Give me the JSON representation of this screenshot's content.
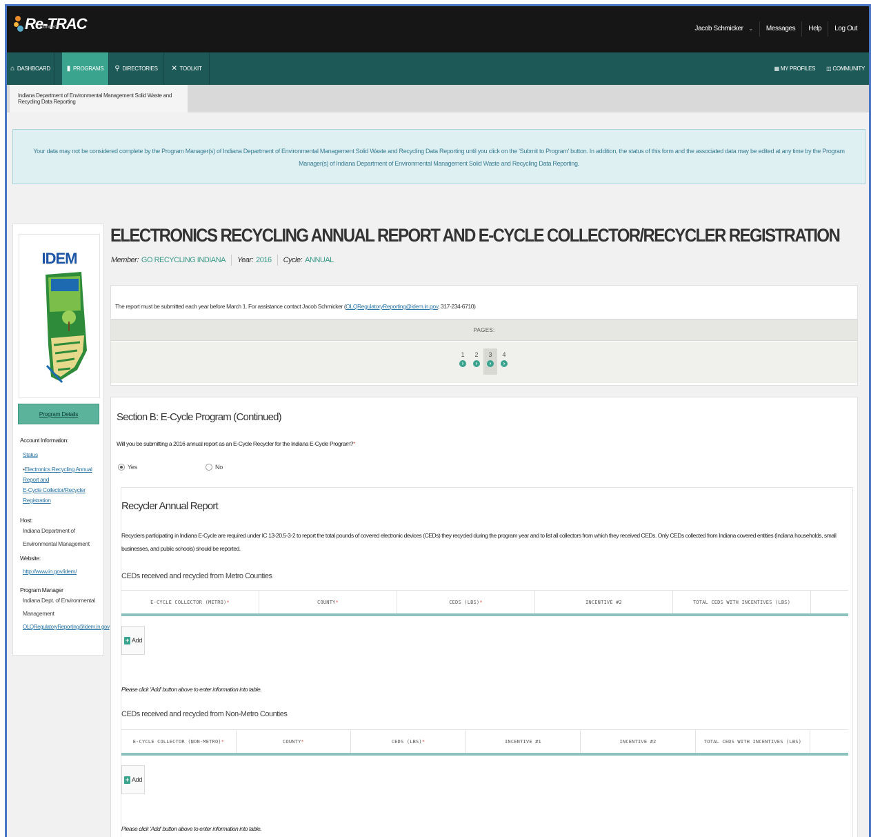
{
  "topbar": {
    "logo": "Re-TRAC",
    "logo_sub": "Connect",
    "user": "Jacob Schmicker",
    "messages": "Messages",
    "help": "Help",
    "logout": "Log Out"
  },
  "mainnav": {
    "dashboard": "DASHBOARD",
    "programs": "PROGRAMS",
    "directories": "DIRECTORIES",
    "toolkit": "TOOLKIT",
    "my_profiles": "MY PROFILES",
    "community": "COMMUNITY"
  },
  "tab": {
    "label": "Indiana Department of Environmental Management Solid Waste and Recycling Data Reporting"
  },
  "alert": {
    "text": "Your data may not be considered complete by the Program Manager(s) of Indiana Department of Environmental Management Solid Waste and Recycling Data Reporting until you click on the 'Submit to Program' button. In addition, the status of this form and the associated data may be edited at any time by the Program Manager(s) of Indiana Department of Environmental Management Solid Waste and Recycling Data Reporting."
  },
  "sidebar": {
    "logo_text": "IDEM",
    "program_details": "Program Details",
    "account_info_label": "Account Information:",
    "status_link": "Status",
    "report_link_1": "Electronics Recycling Annual Report and",
    "report_link_2": "E-Cycle Collector/Recycler Registration",
    "host_label": "Host:",
    "host_1": "Indiana Department of",
    "host_2": "Environmental Management",
    "website_label": "Website:",
    "website": "http://www.in.gov/idem/",
    "manager_label": "Program Manager",
    "manager_1": "Indiana Dept. of Environmental",
    "manager_2": "Management",
    "manager_email": "OLQRegulatoryReporting@idem.in.gov"
  },
  "header": {
    "title": "ELECTRONICS RECYCLING ANNUAL REPORT AND E-CYCLE COLLECTOR/RECYCLER REGISTRATION",
    "member_label": "Member:",
    "member": "GO RECYCLING INDIANA",
    "year_label": "Year:",
    "year": "2016",
    "cycle_label": "Cycle:",
    "cycle": "ANNUAL"
  },
  "info": {
    "text_pre": "The report must be submitted each year before March 1. For assistance contact Jacob Schmicker (",
    "email": "OLQRegulatoryReporting@idem.in.gov",
    "text_post": ", 317-234-6710)",
    "pages_label": "PAGES:",
    "pages": [
      "1",
      "2",
      "3",
      "4"
    ],
    "current_page": 3
  },
  "form": {
    "section_title": "Section B: E-Cycle Program (Continued)",
    "question": "Will you be submitting a 2016 annual report as an E-Cycle Recycler for the Indiana E-Cycle Program?",
    "req_mark": "*",
    "yes": "Yes",
    "no": "No",
    "selected": "Yes",
    "recycler_title": "Recycler Annual Report",
    "recycler_desc": "Recyclers participating in Indiana E-Cycle are required under IC 13-20.5-3-2 to report the total pounds of covered electronic devices (CEDs) they recycled during the program year and to list all collectors from which they received CEDs. Only CEDs collected from Indiana covered entities (Indiana households, small businesses, and public schools) should be reported.",
    "metro_header": "CEDs received and recycled from Metro Counties",
    "metro_columns": [
      "E-CYCLE COLLECTOR (METRO)",
      "COUNTY",
      "CEDS (LBS)",
      "INCENTIVE #2",
      "TOTAL CEDS WITH INCENTIVES (LBS)"
    ],
    "metro_required": [
      true,
      true,
      true,
      false,
      false
    ],
    "add_label": "Add",
    "hint": "Please click 'Add' button above to enter information into table.",
    "nonmetro_header": "CEDs received and recycled from Non-Metro Counties",
    "nonmetro_columns": [
      "E-CYCLE COLLECTOR (NON-METRO)",
      "COUNTY",
      "CEDS (LBS)",
      "INCENTIVE #1",
      "INCENTIVE #2",
      "TOTAL CEDS WITH INCENTIVES (LBS)"
    ],
    "nonmetro_required": [
      true,
      true,
      true,
      false,
      false,
      false
    ]
  }
}
